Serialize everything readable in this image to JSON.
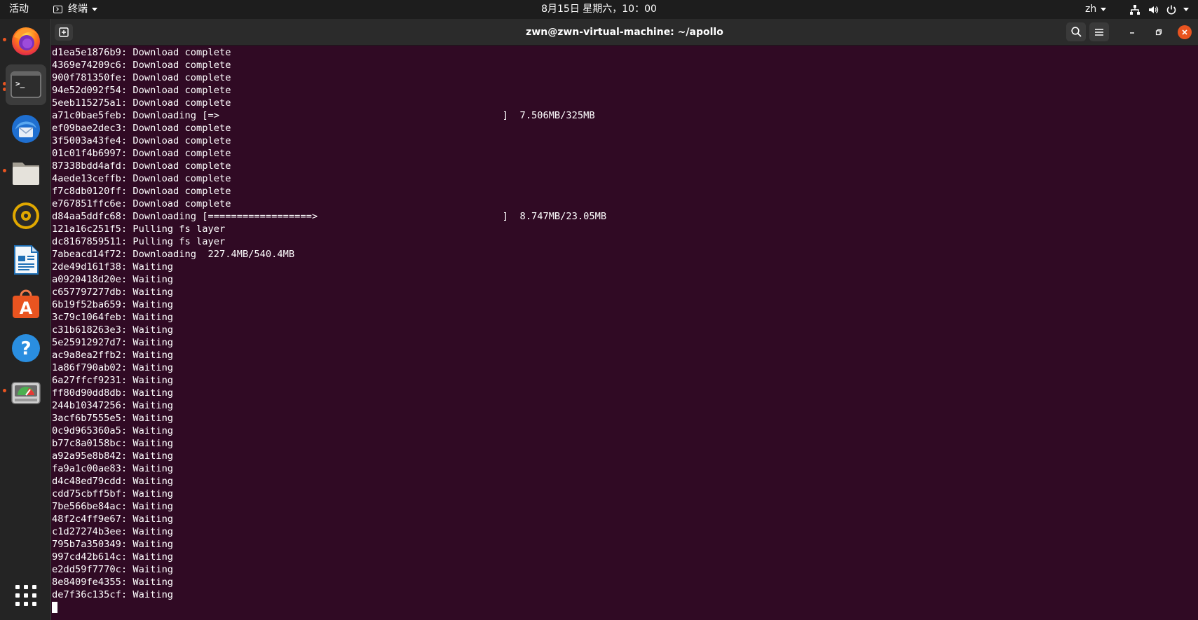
{
  "topbar": {
    "activities": "活动",
    "app_name": "终端",
    "clock": "8月15日 星期六，10：00",
    "lang": "zh"
  },
  "dock": {
    "apps": [
      "firefox-icon",
      "terminal-icon",
      "thunderbird-icon",
      "files-icon",
      "rhythmbox-icon",
      "libreoffice-writer-icon",
      "software-center-icon",
      "help-icon",
      "disk-usage-icon"
    ],
    "show_apps": "show-applications-icon"
  },
  "window": {
    "title": "zwn@zwn-virtual-machine: ~/apollo"
  },
  "terminal": {
    "lines": [
      "d1ea5e1876b9: Download complete",
      "4369e74209c6: Download complete",
      "900f781350fe: Download complete",
      "94e52d092f54: Download complete",
      "5eeb115275a1: Download complete",
      "a71c0bae5feb: Downloading [=>                                                 ]  7.506MB/325MB",
      "ef09bae2dec3: Download complete",
      "3f5003a43fe4: Download complete",
      "01c01f4b6997: Download complete",
      "87338bdd4afd: Download complete",
      "4aede13ceffb: Download complete",
      "f7c8db0120ff: Download complete",
      "e767851ffc6e: Download complete",
      "d84aa5ddfc68: Downloading [==================>                                ]  8.747MB/23.05MB",
      "121a16c251f5: Pulling fs layer",
      "dc8167859511: Pulling fs layer",
      "7abeacd14f72: Downloading  227.4MB/540.4MB",
      "2de49d161f38: Waiting",
      "a0920418d20e: Waiting",
      "c657797277db: Waiting",
      "6b19f52ba659: Waiting",
      "3c79c1064feb: Waiting",
      "c31b618263e3: Waiting",
      "5e25912927d7: Waiting",
      "ac9a8ea2ffb2: Waiting",
      "1a86f790ab02: Waiting",
      "6a27ffcf9231: Waiting",
      "ff80d90dd8db: Waiting",
      "244b10347256: Waiting",
      "3acf6b7555e5: Waiting",
      "0c9d965360a5: Waiting",
      "b77c8a0158bc: Waiting",
      "a92a95e8b842: Waiting",
      "fa9a1c00ae83: Waiting",
      "d4c48ed79cdd: Waiting",
      "cdd75cbff5bf: Waiting",
      "7be566be84ac: Waiting",
      "48f2c4ff9e67: Waiting",
      "c1d27274b3ee: Waiting",
      "795b7a350349: Waiting",
      "997cd42b614c: Waiting",
      "e2dd59f7770c: Waiting",
      "8e8409fe4355: Waiting",
      "de7f36c135cf: Waiting"
    ]
  }
}
